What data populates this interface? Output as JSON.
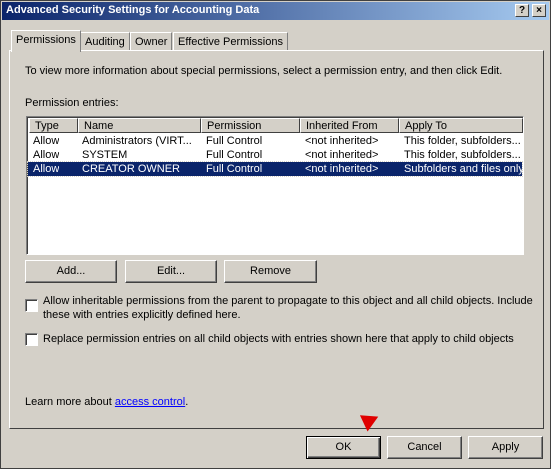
{
  "window": {
    "title": "Advanced Security Settings for Accounting Data",
    "help_label": "?",
    "close_label": "×"
  },
  "tabs": [
    {
      "label": "Permissions"
    },
    {
      "label": "Auditing"
    },
    {
      "label": "Owner"
    },
    {
      "label": "Effective Permissions"
    }
  ],
  "intro_text": "To view more information about special permissions, select a permission entry, and then click Edit.",
  "entries_label": "Permission entries:",
  "columns": [
    "Type",
    "Name",
    "Permission",
    "Inherited From",
    "Apply To"
  ],
  "rows": [
    {
      "type": "Allow",
      "name": "Administrators (VIRT...",
      "permission": "Full Control",
      "inherited": "<not inherited>",
      "apply": "This folder, subfolders..."
    },
    {
      "type": "Allow",
      "name": "SYSTEM",
      "permission": "Full Control",
      "inherited": "<not inherited>",
      "apply": "This folder, subfolders..."
    },
    {
      "type": "Allow",
      "name": "CREATOR OWNER",
      "permission": "Full Control",
      "inherited": "<not inherited>",
      "apply": "Subfolders and files only"
    }
  ],
  "buttons": {
    "add": "Add...",
    "edit": "Edit...",
    "remove": "Remove",
    "ok": "OK",
    "cancel": "Cancel",
    "apply": "Apply"
  },
  "options": {
    "inherit_line1": "Allow inheritable permissions from the parent to propagate to this object and all child objects. Include",
    "inherit_line2": "these with entries explicitly defined here.",
    "replace": "Replace permission entries on all child objects with entries shown here that apply to child objects"
  },
  "footer": {
    "learn_prefix": "Learn more about ",
    "learn_link": "access control",
    "learn_suffix": "."
  },
  "colors": {
    "selection": "#0a246a",
    "title_start": "#0a246a",
    "title_end": "#a6caf0",
    "arrow": "#e00000",
    "link": "#0000ff"
  }
}
